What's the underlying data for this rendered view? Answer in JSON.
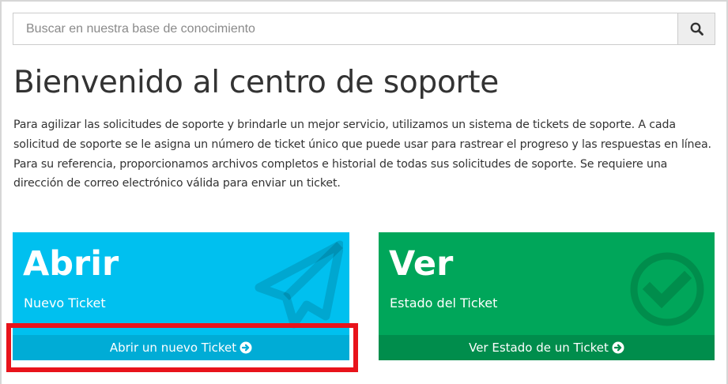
{
  "search": {
    "placeholder": "Buscar en nuestra base de conocimiento",
    "icon": "search-icon"
  },
  "page": {
    "title": "Bienvenido al centro de soporte",
    "intro": "Para agilizar las solicitudes de soporte y brindarle un mejor servicio, utilizamos un sistema de tickets de soporte. A cada solicitud de soporte se le asigna un número de ticket único que puede usar para rastrear el progreso y las respuestas en línea. Para su referencia, proporcionamos archivos completos e historial de todas sus solicitudes de soporte. Se requiere una dirección de correo electrónico válida para enviar un ticket."
  },
  "cards": {
    "open": {
      "heading": "Abrir",
      "subheading": "Nuevo Ticket",
      "link_label": "Abrir un nuevo Ticket",
      "icon": "paper-plane-icon",
      "color": "#00c0ef"
    },
    "view": {
      "heading": "Ver",
      "subheading": "Estado del Ticket",
      "link_label": "Ver Estado de un Ticket",
      "icon": "check-circle-icon",
      "color": "#00a65a"
    }
  },
  "annotation": {
    "color": "#e8131b"
  }
}
